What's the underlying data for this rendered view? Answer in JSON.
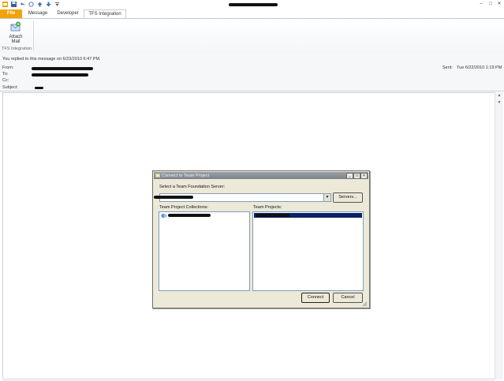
{
  "window": {
    "title_redacted": true,
    "controls": [
      "–",
      "□",
      "✕"
    ]
  },
  "quick_access": {
    "icons": [
      "outlook-icon",
      "save-icon",
      "undo-icon",
      "redo-icon",
      "up-arrow-icon",
      "down-arrow-icon",
      "customize-icon"
    ]
  },
  "tabs": [
    {
      "label": "File"
    },
    {
      "label": "Message"
    },
    {
      "label": "Developer"
    },
    {
      "label": "TFS Integration"
    }
  ],
  "ribbon": {
    "attach_mail_line1": "Attach",
    "attach_mail_line2": "Mail",
    "group_label": "TFS Integration"
  },
  "message": {
    "info_bar": "You replied to this message on 6/23/2010 6:47 PM.",
    "from_label": "From:",
    "to_label": "To:",
    "cc_label": "Cc:",
    "subject_label": "Subject:",
    "sent_label": "Sent:",
    "sent_value": "Tue 6/22/2010 1:19 PM"
  },
  "dialog": {
    "title": "Connect to Team Project",
    "server_label": "Select a Team Foundation Server:",
    "servers_button": "Servers...",
    "collections_label": "Team Project Collections:",
    "projects_label": "Team Projects:",
    "connect_button": "Connect",
    "cancel_button": "Cancel"
  },
  "colors": {
    "file_tab": "#f0a30a",
    "selection": "#0a246a",
    "dialog_face": "#ece9d8"
  }
}
